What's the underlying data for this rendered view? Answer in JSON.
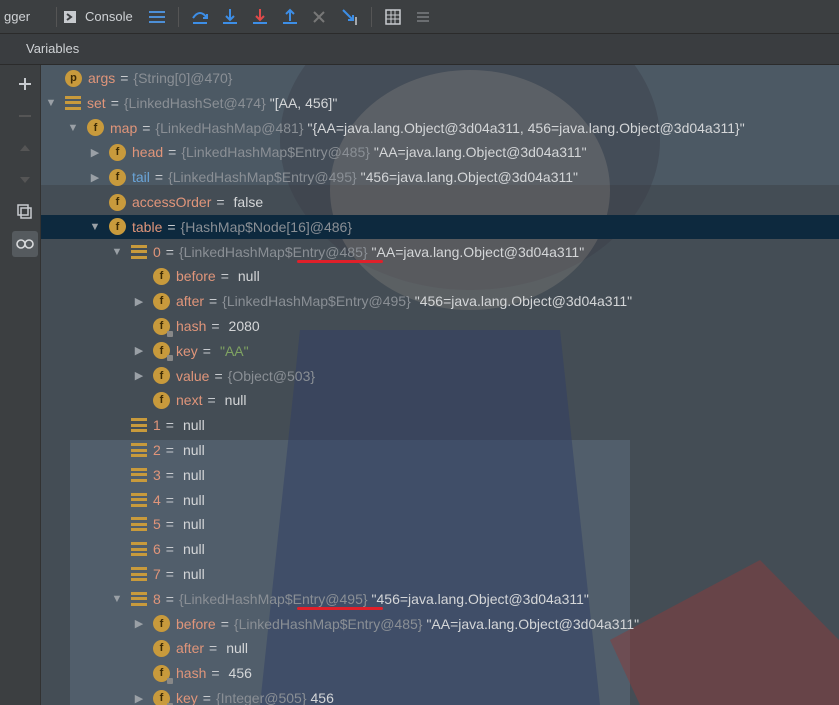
{
  "toolbar": {
    "debugger_tab": "gger",
    "console_tab": "Console"
  },
  "variables_header": "Variables",
  "tree": [
    {
      "indent": 0,
      "arrow": "",
      "icon": "p",
      "name": "args",
      "eq": "=",
      "type": "{String[0]@470}",
      "value": ""
    },
    {
      "indent": 0,
      "arrow": "down",
      "icon": "arr",
      "name": "set",
      "eq": "=",
      "type": "{LinkedHashSet@474}",
      "value": "\"[AA, 456]\""
    },
    {
      "indent": 1,
      "arrow": "down",
      "icon": "f",
      "name": "map",
      "eq": "=",
      "type": "{LinkedHashMap@481}",
      "value": "\"{AA=java.lang.Object@3d04a311, 456=java.lang.Object@3d04a311}\""
    },
    {
      "indent": 2,
      "arrow": "right",
      "icon": "f",
      "name": "head",
      "eq": "=",
      "type": "{LinkedHashMap$Entry@485}",
      "value": "\"AA=java.lang.Object@3d04a311\""
    },
    {
      "indent": 2,
      "arrow": "right",
      "icon": "f",
      "name": "tail",
      "eq": "=",
      "type": "{LinkedHashMap$Entry@495}",
      "value": "\"456=java.lang.Object@3d04a311\"",
      "blue": true
    },
    {
      "indent": 2,
      "arrow": "",
      "icon": "f",
      "name": "accessOrder",
      "eq": "=",
      "type": "",
      "value": "false"
    },
    {
      "indent": 2,
      "arrow": "down",
      "icon": "f",
      "name": "table",
      "eq": "=",
      "type": "{HashMap$Node[16]@486}",
      "value": "",
      "selected": true
    },
    {
      "indent": 3,
      "arrow": "down",
      "icon": "arr",
      "name": "0",
      "eq": "=",
      "type": "{LinkedHashMap$Entry@485}",
      "value": "\"AA=java.lang.Object@3d04a311\""
    },
    {
      "indent": 4,
      "arrow": "",
      "icon": "f",
      "name": "before",
      "eq": "=",
      "type": "",
      "value": "null"
    },
    {
      "indent": 4,
      "arrow": "right",
      "icon": "f",
      "name": "after",
      "eq": "=",
      "type": "{LinkedHashMap$Entry@495}",
      "value": "\"456=java.lang.Object@3d04a311\""
    },
    {
      "indent": 4,
      "arrow": "",
      "icon": "fl",
      "name": "hash",
      "eq": "=",
      "type": "",
      "value": "2080"
    },
    {
      "indent": 4,
      "arrow": "right",
      "icon": "fl",
      "name": "key",
      "eq": "=",
      "type": "",
      "value": "\"AA\"",
      "str": true
    },
    {
      "indent": 4,
      "arrow": "right",
      "icon": "f",
      "name": "value",
      "eq": "=",
      "type": "{Object@503}",
      "value": ""
    },
    {
      "indent": 4,
      "arrow": "",
      "icon": "f",
      "name": "next",
      "eq": "=",
      "type": "",
      "value": "null"
    },
    {
      "indent": 3,
      "arrow": "",
      "icon": "arr",
      "name": "1",
      "eq": "=",
      "type": "",
      "value": "null"
    },
    {
      "indent": 3,
      "arrow": "",
      "icon": "arr",
      "name": "2",
      "eq": "=",
      "type": "",
      "value": "null"
    },
    {
      "indent": 3,
      "arrow": "",
      "icon": "arr",
      "name": "3",
      "eq": "=",
      "type": "",
      "value": "null"
    },
    {
      "indent": 3,
      "arrow": "",
      "icon": "arr",
      "name": "4",
      "eq": "=",
      "type": "",
      "value": "null"
    },
    {
      "indent": 3,
      "arrow": "",
      "icon": "arr",
      "name": "5",
      "eq": "=",
      "type": "",
      "value": "null"
    },
    {
      "indent": 3,
      "arrow": "",
      "icon": "arr",
      "name": "6",
      "eq": "=",
      "type": "",
      "value": "null"
    },
    {
      "indent": 3,
      "arrow": "",
      "icon": "arr",
      "name": "7",
      "eq": "=",
      "type": "",
      "value": "null"
    },
    {
      "indent": 3,
      "arrow": "down",
      "icon": "arr",
      "name": "8",
      "eq": "=",
      "type": "{LinkedHashMap$Entry@495}",
      "value": "\"456=java.lang.Object@3d04a311\""
    },
    {
      "indent": 4,
      "arrow": "right",
      "icon": "f",
      "name": "before",
      "eq": "=",
      "type": "{LinkedHashMap$Entry@485}",
      "value": "\"AA=java.lang.Object@3d04a311\""
    },
    {
      "indent": 4,
      "arrow": "",
      "icon": "f",
      "name": "after",
      "eq": "=",
      "type": "",
      "value": "null"
    },
    {
      "indent": 4,
      "arrow": "",
      "icon": "fl",
      "name": "hash",
      "eq": "=",
      "type": "",
      "value": "456"
    },
    {
      "indent": 4,
      "arrow": "right",
      "icon": "fl",
      "name": "key",
      "eq": "=",
      "type": "{Integer@505}",
      "value": "456"
    }
  ],
  "colors": {
    "background": "#3c3f41",
    "selection": "#0d293e",
    "field_name": "#e0957a",
    "type_text": "#8a8f95",
    "string_value": "#7fa362",
    "underline_annotation": "#e0202a"
  }
}
